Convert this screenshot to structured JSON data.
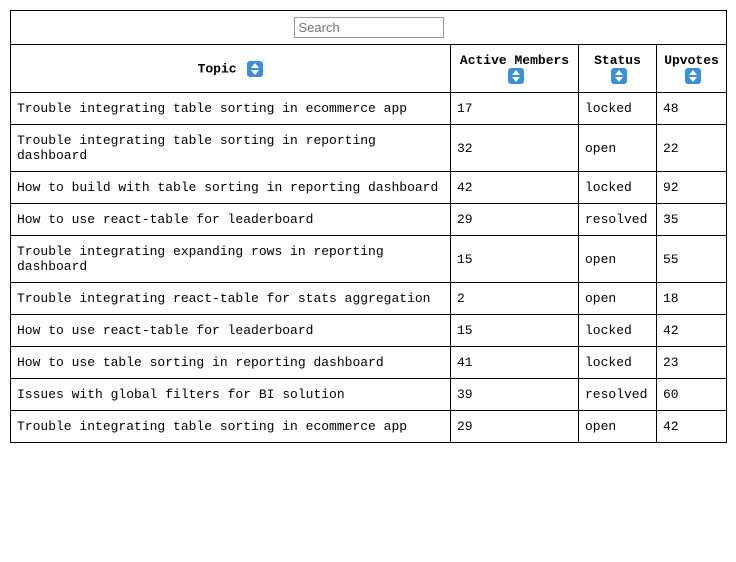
{
  "search": {
    "placeholder": "Search",
    "value": ""
  },
  "columns": [
    {
      "key": "topic",
      "label": "Topic"
    },
    {
      "key": "members",
      "label": "Active Members"
    },
    {
      "key": "status",
      "label": "Status"
    },
    {
      "key": "upvotes",
      "label": "Upvotes"
    }
  ],
  "rows": [
    {
      "topic": "Trouble integrating table sorting in ecommerce app",
      "members": "17",
      "status": "locked",
      "upvotes": "48"
    },
    {
      "topic": "Trouble integrating table sorting in reporting dashboard",
      "members": "32",
      "status": "open",
      "upvotes": "22"
    },
    {
      "topic": "How to build with table sorting in reporting dashboard",
      "members": "42",
      "status": "locked",
      "upvotes": "92"
    },
    {
      "topic": "How to use react-table for leaderboard",
      "members": "29",
      "status": "resolved",
      "upvotes": "35"
    },
    {
      "topic": "Trouble integrating expanding rows in reporting dashboard",
      "members": "15",
      "status": "open",
      "upvotes": "55"
    },
    {
      "topic": "Trouble integrating react-table for stats aggregation",
      "members": "2",
      "status": "open",
      "upvotes": "18"
    },
    {
      "topic": "How to use react-table for leaderboard",
      "members": "15",
      "status": "locked",
      "upvotes": "42"
    },
    {
      "topic": "How to use table sorting in reporting dashboard",
      "members": "41",
      "status": "locked",
      "upvotes": "23"
    },
    {
      "topic": "Issues with global filters for BI solution",
      "members": "39",
      "status": "resolved",
      "upvotes": "60"
    },
    {
      "topic": "Trouble integrating table sorting in ecommerce app",
      "members": "29",
      "status": "open",
      "upvotes": "42"
    }
  ]
}
